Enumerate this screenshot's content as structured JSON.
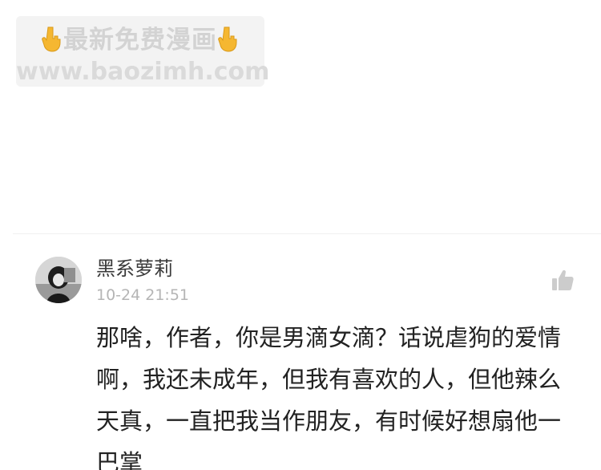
{
  "watermark": {
    "title": "最新免费漫画",
    "url": "www.baozimh.com",
    "hand_icon": "pointing-down-hand-icon"
  },
  "comment": {
    "username": "黑系萝莉",
    "timestamp": "10-24 21:51",
    "text": "那啥，作者，你是男滴女滴？话说虐狗的爱情啊，我还未成年，但我有喜欢的人，但他辣么天真，一直把我当作朋友，有时候好想扇他一巴掌",
    "like_icon": "thumbs-up-icon",
    "avatar_icon": "user-avatar"
  },
  "colors": {
    "watermark_bg": "#f3f3f3",
    "watermark_text": "#d3d3d3",
    "hand": "#f5b731",
    "username": "#3a3a3a",
    "timestamp": "#b5b5b5",
    "comment_text": "#222222",
    "like_icon": "#cccccc"
  }
}
